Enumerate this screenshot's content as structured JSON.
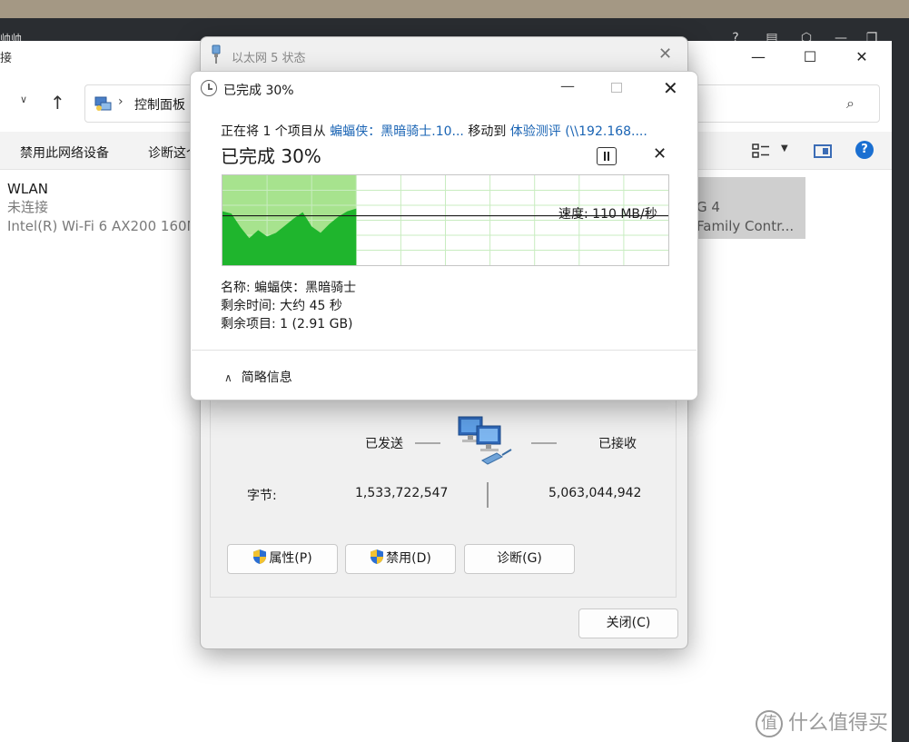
{
  "explorer": {
    "window_title_fragment": "接",
    "breadcrumb": "控制面板",
    "commands": [
      "禁用此网络设备",
      "诊断这个"
    ],
    "adapters": [
      {
        "name": "WLAN",
        "status": "未连接",
        "device": "Intel(R) Wi-Fi 6 AX200 160MHz"
      }
    ],
    "adapter_partial_line1": "G 4",
    "adapter_partial_line2": "Family Contr...",
    "taskbar_fragment": "帅帅"
  },
  "status_dialog": {
    "title": "以太网 5 状态",
    "sent_label": "已发送",
    "received_label": "已接收",
    "bytes_label": "字节:",
    "bytes_sent": "1,533,722,547",
    "bytes_received": "5,063,044,942",
    "buttons": {
      "properties": "属性(P)",
      "disable": "禁用(D)",
      "diagnose": "诊断(G)",
      "close": "关闭(C)"
    }
  },
  "copy_dialog": {
    "title": "已完成 30%",
    "line_prefix": "正在将 1 个项目从 ",
    "source": "蝙蝠侠：黑暗骑士.10...",
    "line_mid": " 移动到 ",
    "destination": "体验测评 (\\\\192.168....",
    "big_status": "已完成 30%",
    "speed_label": "速度: 110 MB/秒",
    "name_line": "名称: 蝙蝠侠：黑暗骑士",
    "time_line": "剩余时间: 大约 45 秒",
    "items_line": "剩余项目: 1 (2.91 GB)",
    "less_details": "简略信息",
    "progress_fraction": 0.3,
    "chart_data": {
      "type": "area",
      "x": [
        0,
        0.02,
        0.04,
        0.06,
        0.08,
        0.1,
        0.12,
        0.14,
        0.16,
        0.18,
        0.2,
        0.22,
        0.24,
        0.26,
        0.28,
        0.3
      ],
      "values": [
        120,
        115,
        85,
        60,
        78,
        64,
        72,
        88,
        104,
        118,
        86,
        72,
        92,
        108,
        120,
        126
      ],
      "current_speed": 110,
      "ylim": [
        0,
        200
      ],
      "xlim": [
        0,
        1
      ],
      "grid": true
    },
    "colors": {
      "fill_done_bg": "#a7e38e",
      "fill_series": "#1fb52d",
      "grid": "#c8ecc0",
      "link": "#1a64b4"
    }
  },
  "watermark": "什么值得买"
}
